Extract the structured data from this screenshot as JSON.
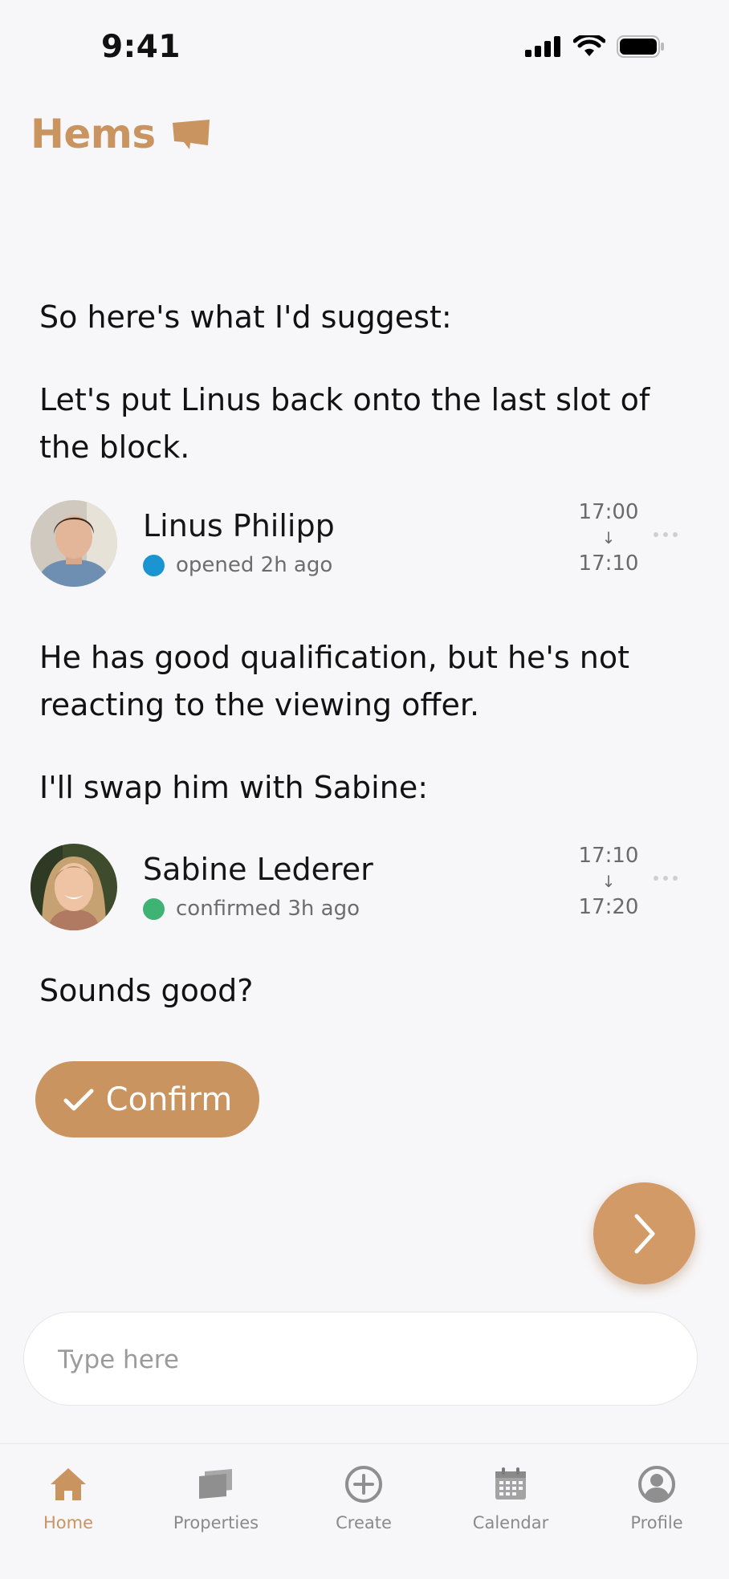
{
  "status": {
    "time": "9:41"
  },
  "brand": {
    "name": "Hems"
  },
  "messages": {
    "intro": "So here's what I'd suggest:",
    "linus_plan": "Let's put Linus back onto the last slot of the block.",
    "reason": "He has good qualification, but he's not reacting to the viewing offer.",
    "swap": "I'll swap him with Sabine:",
    "question": "Sounds good?"
  },
  "slots": [
    {
      "name": "Linus Philipp",
      "status": "opened 2h ago",
      "status_color": "#1a95d2",
      "start": "17:00",
      "end": "17:10",
      "arrow": "↓"
    },
    {
      "name": "Sabine Lederer",
      "status": "confirmed 3h ago",
      "status_color": "#3fb374",
      "start": "17:10",
      "end": "17:20",
      "arrow": "↓"
    }
  ],
  "actions": {
    "confirm_label": "Confirm",
    "next_icon": "chevron-right-icon"
  },
  "composer": {
    "placeholder": "Type here"
  },
  "tabs": [
    {
      "label": "Home",
      "icon": "home-icon",
      "active": true
    },
    {
      "label": "Properties",
      "icon": "properties-icon",
      "active": false
    },
    {
      "label": "Create",
      "icon": "plus-circle-icon",
      "active": false
    },
    {
      "label": "Calendar",
      "icon": "calendar-icon",
      "active": false
    },
    {
      "label": "Profile",
      "icon": "profile-icon",
      "active": false
    }
  ],
  "colors": {
    "accent": "#c9945f",
    "background": "#f7f6f8",
    "inactive": "#8a8a8a"
  }
}
